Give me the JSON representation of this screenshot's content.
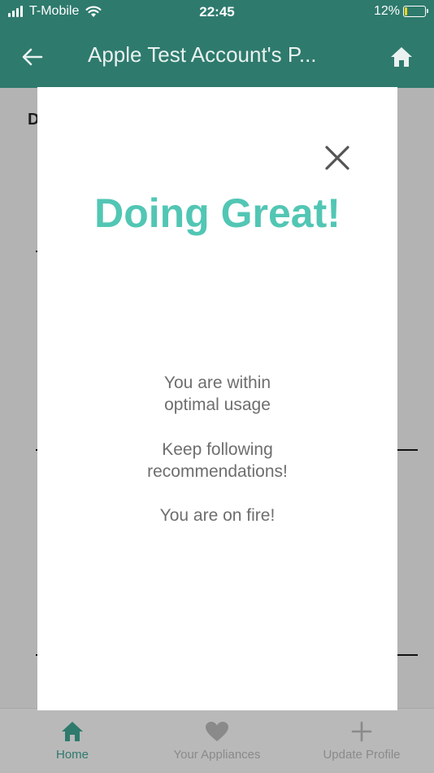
{
  "status_bar": {
    "carrier": "T-Mobile",
    "time": "22:45",
    "battery_percent": "12%",
    "battery_level": 0.12,
    "battery_color": "#f7d21a"
  },
  "app_bar": {
    "title": "Apple Test Account's P...",
    "back_icon": "arrow-left-icon",
    "home_icon": "home-icon",
    "color": "#2e7a6d"
  },
  "background": {
    "heading_fragment": "D"
  },
  "modal": {
    "title": "Doing Great!",
    "title_color": "#52c6b4",
    "close_icon": "close-icon",
    "messages": [
      {
        "lines": [
          "You are within",
          "optimal usage"
        ]
      },
      {
        "lines": [
          "Keep following",
          "recommendations!"
        ]
      },
      {
        "lines": [
          "You are on fire!"
        ]
      }
    ]
  },
  "tabs": [
    {
      "label": "Home",
      "icon": "home-icon",
      "active": true
    },
    {
      "label": "Your Appliances",
      "icon": "heart-icon",
      "active": false
    },
    {
      "label": "Update Profile",
      "icon": "plus-icon",
      "active": false
    }
  ]
}
